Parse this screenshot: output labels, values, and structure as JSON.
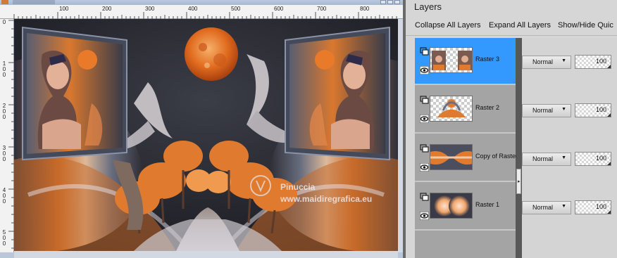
{
  "ruler": {
    "top_labels": [
      "100",
      "200",
      "300",
      "400",
      "500",
      "600",
      "700",
      "800"
    ],
    "left_labels": [
      "0",
      "1\n0\n0",
      "2\n0\n0",
      "3\n0\n0",
      "4\n0\n0",
      "5\n0\n0"
    ]
  },
  "canvas": {
    "watermark_title": "Pinuccia",
    "watermark_url": "www.maidiregrafica.eu"
  },
  "layers_panel": {
    "title": "Layers",
    "toolbar": {
      "collapse": "Collapse All Layers",
      "expand": "Expand All Layers",
      "show_hide": "Show/Hide Quic"
    },
    "layers": [
      {
        "name": "Raster 3",
        "blend": "Normal",
        "opacity": "100",
        "selected": true
      },
      {
        "name": "Raster 2",
        "blend": "Normal",
        "opacity": "100",
        "selected": false
      },
      {
        "name": "Copy of Raster",
        "blend": "Normal",
        "opacity": "100",
        "selected": false
      },
      {
        "name": "Raster 1",
        "blend": "Normal",
        "opacity": "100",
        "selected": false
      }
    ]
  },
  "colors": {
    "selection": "#3399ff",
    "accent_orange": "#e0762c"
  }
}
